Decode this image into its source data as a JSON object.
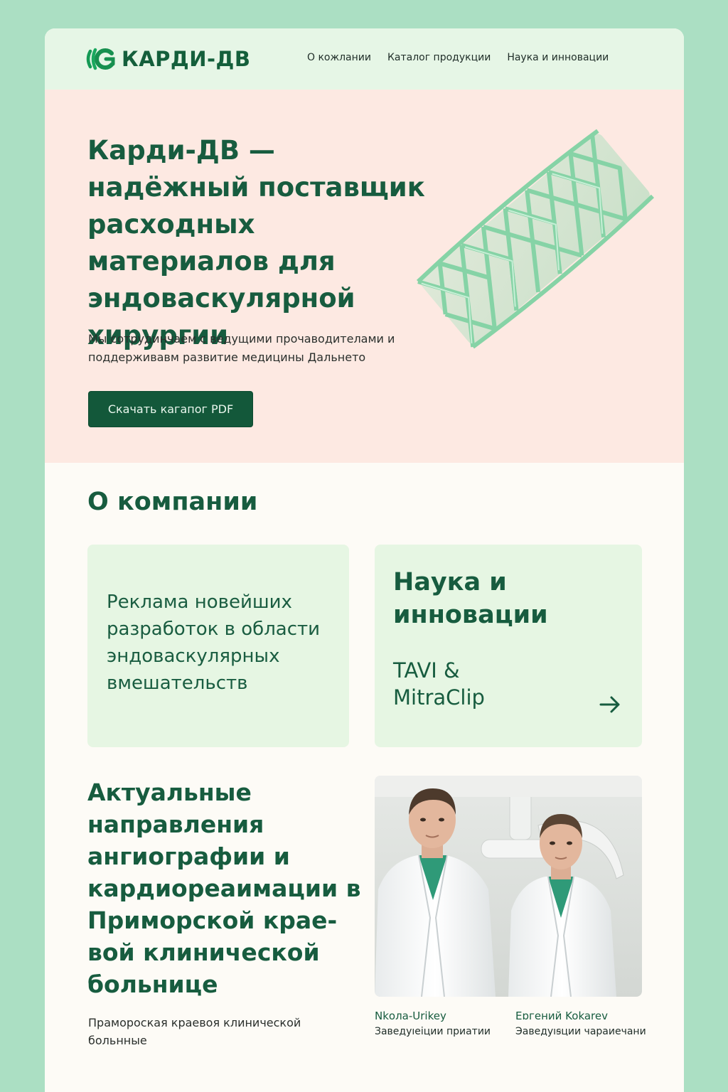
{
  "brand": {
    "name": "КАРДИ-ДВ",
    "accent": "#175c3f",
    "background": "#abdfc3",
    "hero_bg": "#fde9e2",
    "card_bg": "#e6f6e3"
  },
  "nav": {
    "items": [
      {
        "label": "О кожлании"
      },
      {
        "label": "Каталог продукции"
      },
      {
        "label": "Наука и инновации"
      }
    ]
  },
  "hero": {
    "title": "Карди-ДВ — надёжный поставщик расходных материалов для эндоваскулярной хирургии",
    "subtitle": "Мы сотрудинчаем с ведущими прочаводителами и поддерживавм развитие медицины Дальнето",
    "cta_label": "Скачать кагапог PDF",
    "illustration_icon": "stent-illustration"
  },
  "about": {
    "title": "О компании",
    "card_left_text": "Реклама новейших разработок в области эндоваскулярных вмешательств",
    "card_right": {
      "title": "Наука и инновации",
      "subtitle": "TAVI & MitraClip",
      "icon": "arrow-right-icon"
    }
  },
  "directions": {
    "title": "Актуальные направления ангиографии и кардиореаимации в Приморской крае-вой клинической больнице",
    "subtitle": "Прамороская краевоя клинической больнные",
    "people": [
      {
        "name": "Nkола-Urikey",
        "role": "Заведуıeiции приатии"
      },
      {
        "name": "Eɒгений Kokarev",
        "role": "Эаведуıꞩции чараиечани"
      }
    ]
  }
}
